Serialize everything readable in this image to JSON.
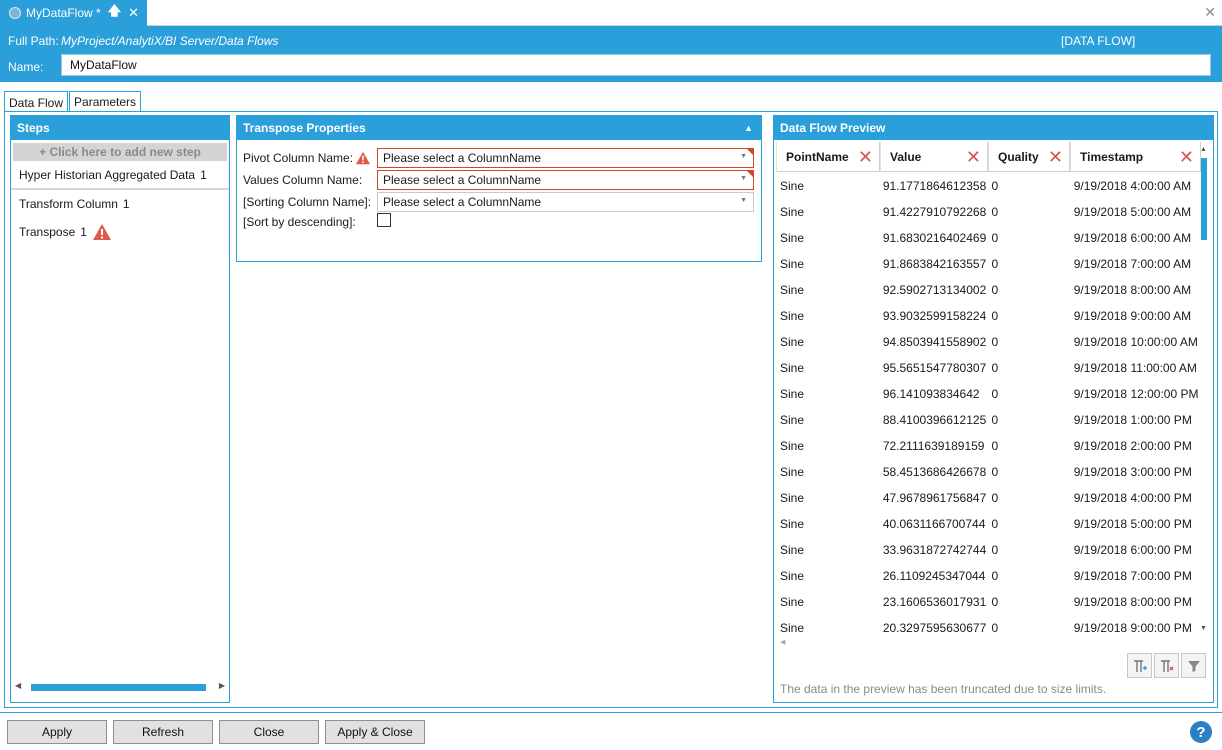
{
  "document_tab": {
    "title": "MyDataFlow *",
    "pin_icon": "pin-icon",
    "close_icon": "close-icon"
  },
  "window": {
    "close_glyph": "✕"
  },
  "header": {
    "full_path_label": "Full Path:",
    "full_path_value": "MyProject/AnalytiX/BI Server/Data Flows",
    "type_label": "[DATA FLOW]",
    "name_label": "Name:",
    "name_value": "MyDataFlow"
  },
  "tabs": [
    {
      "label": "Data Flow",
      "active": true
    },
    {
      "label": "Parameters",
      "active": false
    }
  ],
  "steps": {
    "title": "Steps",
    "add_label": "+ Click here to add new step",
    "items": [
      {
        "label": "Hyper Historian Aggregated Data",
        "count": "1",
        "warning": false
      },
      {
        "label": "Transform Column",
        "count": "1",
        "warning": false
      },
      {
        "label": "Transpose",
        "count": "1",
        "warning": true
      }
    ]
  },
  "properties": {
    "title": "Transpose Properties",
    "pivot_label": "Pivot Column Name:",
    "pivot_value": "Please select a ColumnName",
    "values_label": "Values Column Name:",
    "values_value": "Please select a ColumnName",
    "sorting_label": "[Sorting Column Name]:",
    "sorting_value": "Please select a ColumnName",
    "sort_desc_label": "[Sort by descending]:",
    "sort_desc_checked": false
  },
  "preview": {
    "title": "Data Flow Preview",
    "columns": [
      "PointName",
      "Value",
      "Quality",
      "Timestamp"
    ],
    "rows": [
      [
        "Sine",
        "91.1771864612358",
        "0",
        "9/19/2018 4:00:00 AM"
      ],
      [
        "Sine",
        "91.4227910792268",
        "0",
        "9/19/2018 5:00:00 AM"
      ],
      [
        "Sine",
        "91.6830216402469",
        "0",
        "9/19/2018 6:00:00 AM"
      ],
      [
        "Sine",
        "91.8683842163557",
        "0",
        "9/19/2018 7:00:00 AM"
      ],
      [
        "Sine",
        "92.5902713134002",
        "0",
        "9/19/2018 8:00:00 AM"
      ],
      [
        "Sine",
        "93.9032599158224",
        "0",
        "9/19/2018 9:00:00 AM"
      ],
      [
        "Sine",
        "94.8503941558902",
        "0",
        "9/19/2018 10:00:00 AM"
      ],
      [
        "Sine",
        "95.5651547780307",
        "0",
        "9/19/2018 11:00:00 AM"
      ],
      [
        "Sine",
        "96.141093834642",
        "0",
        "9/19/2018 12:00:00 PM"
      ],
      [
        "Sine",
        "88.4100396612125",
        "0",
        "9/19/2018 1:00:00 PM"
      ],
      [
        "Sine",
        "72.2111639189159",
        "0",
        "9/19/2018 2:00:00 PM"
      ],
      [
        "Sine",
        "58.4513686426678",
        "0",
        "9/19/2018 3:00:00 PM"
      ],
      [
        "Sine",
        "47.9678961756847",
        "0",
        "9/19/2018 4:00:00 PM"
      ],
      [
        "Sine",
        "40.0631166700744",
        "0",
        "9/19/2018 5:00:00 PM"
      ],
      [
        "Sine",
        "33.9631872742744",
        "0",
        "9/19/2018 6:00:00 PM"
      ],
      [
        "Sine",
        "26.1109245347044",
        "0",
        "9/19/2018 7:00:00 PM"
      ],
      [
        "Sine",
        "23.1606536017931",
        "0",
        "9/19/2018 8:00:00 PM"
      ],
      [
        "Sine",
        "20.3297595630677",
        "0",
        "9/19/2018 9:00:00 PM"
      ]
    ],
    "note": "The data in the preview has been truncated due to size limits.",
    "tools": [
      "add-column-icon",
      "remove-column-icon",
      "filter-icon"
    ]
  },
  "footer": {
    "apply": "Apply",
    "refresh": "Refresh",
    "close": "Close",
    "apply_close": "Apply & Close",
    "help_glyph": "?"
  },
  "colors": {
    "accent": "#2b9fd9",
    "error": "#d04a2a",
    "warning": "#e05a4a",
    "clear_column": "#d9534f"
  }
}
